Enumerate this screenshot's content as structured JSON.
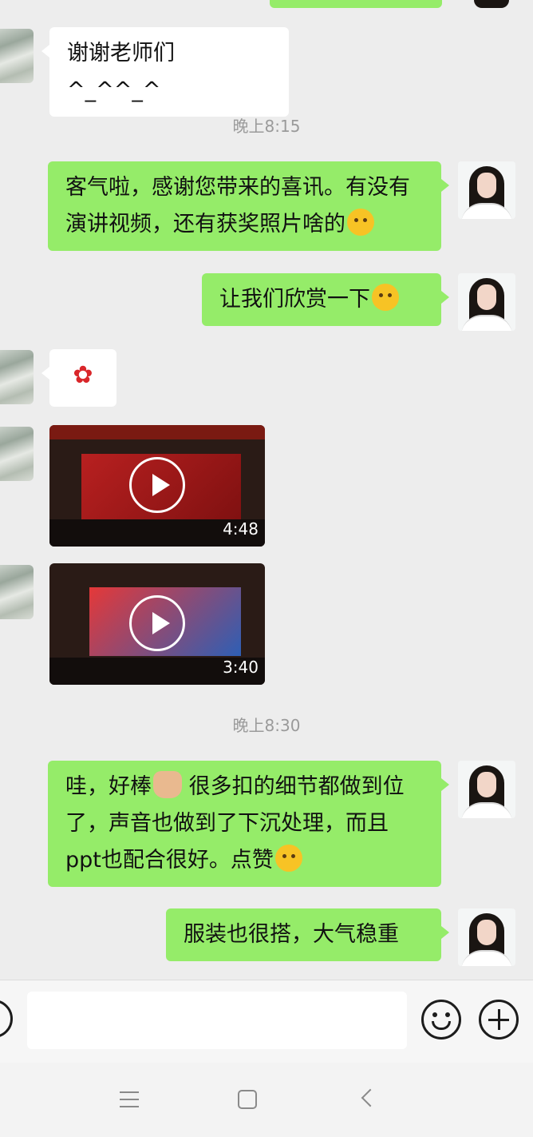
{
  "messages": {
    "m1": {
      "text": "谢谢老师们 ^_^^_^"
    },
    "t1": {
      "text": "晚上8:15"
    },
    "m2": {
      "text": "客气啦，感谢您带来的喜讯。有没有演讲视频，还有获奖照片啥的"
    },
    "m3": {
      "text": "让我们欣赏一下"
    },
    "m4": {
      "emoji": "rose"
    },
    "v1": {
      "duration": "4:48"
    },
    "v2": {
      "duration": "3:40"
    },
    "t2": {
      "text": "晚上8:30"
    },
    "m5": {
      "part1": "哇，好棒",
      "part2": " 很多扣的细节都做到位了，声音也做到了下沉处理，而且ppt也配合很好。点赞"
    },
    "m6": {
      "text": "服装也很搭，大气稳重"
    }
  },
  "icons": {
    "voice": "voice-icon",
    "emoji": "emoji-icon",
    "plus": "plus-icon",
    "nav_menu": "menu-icon",
    "nav_home": "home-icon",
    "nav_back": "back-icon"
  },
  "colors": {
    "bubble_green": "#95ec69",
    "background": "#ededed"
  }
}
